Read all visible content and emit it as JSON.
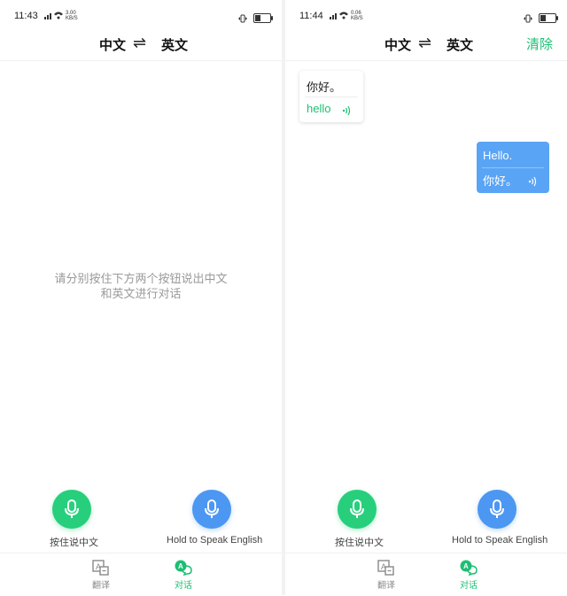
{
  "left_screen": {
    "status": {
      "time": "11:43",
      "speed": "3.00\nKB/S",
      "battery_level": 0.35
    },
    "header": {
      "source_lang": "中文",
      "swap_glyph": "⇌",
      "target_lang": "英文"
    },
    "empty_hint_line1": "请分别按住下方两个按钮说出中文",
    "empty_hint_line2": "和英文进行对话",
    "mic_left_label": "按住说中文",
    "mic_right_label": "Hold to Speak English",
    "nav": [
      {
        "label": "翻译",
        "active": false
      },
      {
        "label": "对话",
        "active": true
      }
    ]
  },
  "right_screen": {
    "status": {
      "time": "11:44",
      "speed": "0.06\nKB/S",
      "battery_level": 0.35
    },
    "header": {
      "source_lang": "中文",
      "swap_glyph": "⇌",
      "target_lang": "英文",
      "clear_label": "清除"
    },
    "messages": [
      {
        "side": "left",
        "original": "你好。",
        "translation": "hello"
      },
      {
        "side": "right",
        "original": "Hello.",
        "translation": "你好。"
      }
    ],
    "mic_left_label": "按住说中文",
    "mic_right_label": "Hold to Speak English",
    "nav": [
      {
        "label": "翻译",
        "active": false
      },
      {
        "label": "对话",
        "active": true
      }
    ]
  },
  "colors": {
    "accent_green": "#1dbf73",
    "mic_green": "#27cf7c",
    "mic_blue": "#4c97f1",
    "bubble_blue": "#5aa4f5"
  },
  "icons": {
    "mic": "microphone-icon",
    "speaker": "speaker-icon",
    "translate_tab": "translate-icon",
    "dialog_tab": "dialog-icon"
  }
}
